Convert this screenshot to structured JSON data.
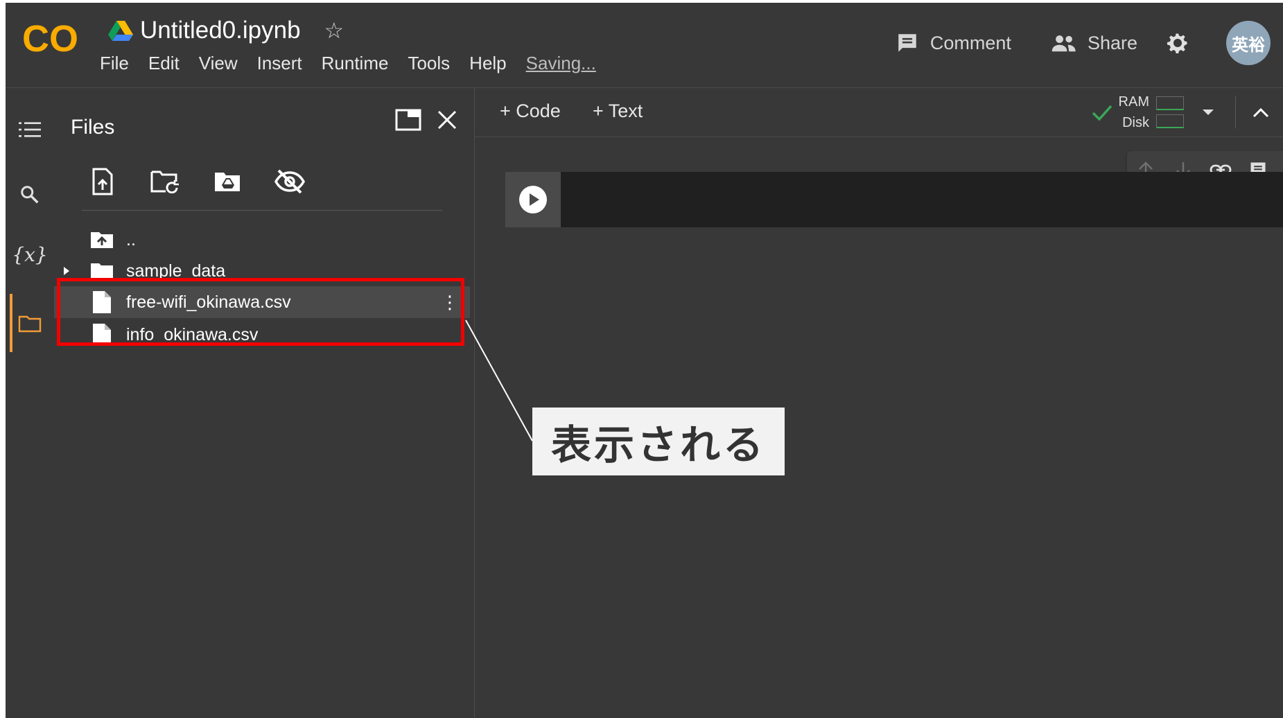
{
  "header": {
    "logo_text": "CO",
    "doc_title": "Untitled0.ipynb",
    "menu": [
      "File",
      "Edit",
      "View",
      "Insert",
      "Runtime",
      "Tools",
      "Help"
    ],
    "save_status": "Saving...",
    "comment_label": "Comment",
    "share_label": "Share",
    "avatar_text": "英裕"
  },
  "sidebar": {
    "rail_icons": [
      "toc-icon",
      "search-icon",
      "variables-icon",
      "folder-icon"
    ],
    "variables_glyph": "{x}",
    "active_item": "folder-icon",
    "accent_color": "#f19c38"
  },
  "files_panel": {
    "title": "Files",
    "toolbar_icons": [
      "upload-file-icon",
      "refresh-folder-icon",
      "mount-drive-icon",
      "hide-files-icon"
    ],
    "items": [
      {
        "label": "..",
        "type": "parent"
      },
      {
        "label": "sample_data",
        "type": "folder"
      },
      {
        "label": "free-wifi_okinawa.csv",
        "type": "file"
      },
      {
        "label": "info_okinawa.csv",
        "type": "file"
      }
    ]
  },
  "notebook": {
    "add_code_label": "+ Code",
    "add_text_label": "+ Text",
    "ram_label": "RAM",
    "disk_label": "Disk"
  },
  "annotation": {
    "text": "表示される",
    "box_color": "#f20000"
  }
}
